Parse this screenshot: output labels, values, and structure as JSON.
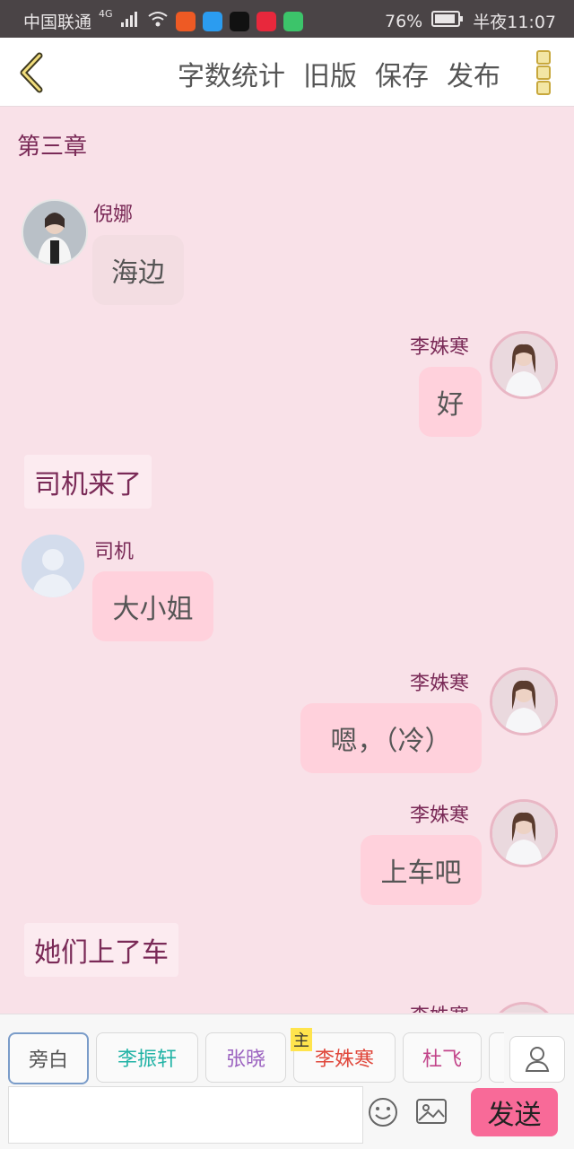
{
  "status_bar": {
    "carrier": "中国联通",
    "network": "4G",
    "battery": "76%",
    "time": "半夜11:07"
  },
  "toolbar": {
    "word_count": "字数统计",
    "old_version": "旧版",
    "save": "保存",
    "publish": "发布"
  },
  "chapter_title": "第三章",
  "messages": [
    {
      "speaker": "倪娜",
      "text": "海边"
    },
    {
      "speaker": "李姝寒",
      "text": "好"
    },
    {
      "narration": "司机来了"
    },
    {
      "speaker": "司机",
      "text": "大小姐"
    },
    {
      "speaker": "李姝寒",
      "text": "嗯，（冷）"
    },
    {
      "speaker": "李姝寒",
      "text": "上车吧"
    },
    {
      "narration": "她们上了车"
    },
    {
      "speaker": "李姝寒"
    }
  ],
  "roles": [
    {
      "label": "旁白",
      "color": "#555555"
    },
    {
      "label": "李振轩",
      "color": "#22b3a6"
    },
    {
      "label": "张晓",
      "color": "#9b62c0"
    },
    {
      "label": "李姝寒",
      "color": "#e0483c",
      "tag": "主"
    },
    {
      "label": "杜飞",
      "color": "#c2448a"
    }
  ],
  "composer": {
    "placeholder": "",
    "send_label": "发送"
  },
  "colors": {
    "background": "#f9e1e8",
    "accent": "#f86a98",
    "name_color": "#7a2a57"
  }
}
